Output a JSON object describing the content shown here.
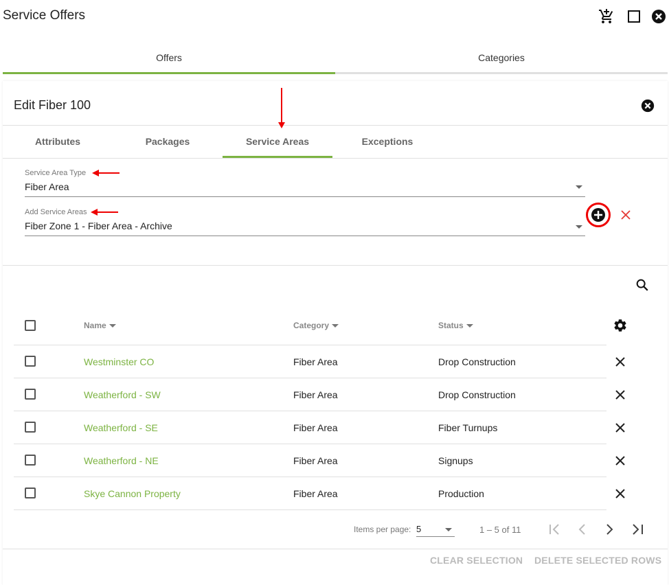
{
  "window": {
    "title": "Service Offers",
    "icons": [
      "add-to-cart-icon",
      "maximize-icon",
      "close-circle-icon"
    ]
  },
  "top_tabs": [
    {
      "label": "Offers",
      "active": true
    },
    {
      "label": "Categories",
      "active": false
    }
  ],
  "editor": {
    "title": "Edit Fiber 100",
    "tabs": [
      {
        "label": "Attributes"
      },
      {
        "label": "Packages"
      },
      {
        "label": "Service Areas",
        "active": true
      },
      {
        "label": "Exceptions"
      }
    ],
    "service_area_type": {
      "label": "Service Area Type",
      "value": "Fiber Area"
    },
    "add_service_areas": {
      "label": "Add Service Areas",
      "value": "Fiber Zone 1 - Fiber Area - Archive"
    }
  },
  "table": {
    "columns": [
      "Name",
      "Category",
      "Status"
    ],
    "rows": [
      {
        "name": "Westminster CO",
        "category": "Fiber Area",
        "status": "Drop Construction"
      },
      {
        "name": "Weatherford - SW",
        "category": "Fiber Area",
        "status": "Drop Construction"
      },
      {
        "name": "Weatherford - SE",
        "category": "Fiber Area",
        "status": "Fiber Turnups"
      },
      {
        "name": "Weatherford - NE",
        "category": "Fiber Area",
        "status": "Signups"
      },
      {
        "name": "Skye Cannon Property",
        "category": "Fiber Area",
        "status": "Production"
      }
    ]
  },
  "pagination": {
    "items_per_page_label": "Items per page:",
    "items_per_page": "5",
    "range": "1 – 5 of 11"
  },
  "actions": {
    "clear": "CLEAR SELECTION",
    "delete": "DELETE SELECTED ROWS"
  },
  "colors": {
    "accent": "#7cb342",
    "annotation": "#e00000",
    "link": "#7cb342"
  }
}
